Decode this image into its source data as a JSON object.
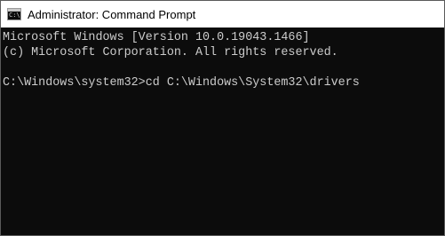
{
  "window": {
    "title": "Administrator: Command Prompt",
    "icon": "cmd-icon",
    "icon_glyph": "C:\\"
  },
  "console": {
    "lines": [
      "Microsoft Windows [Version 10.0.19043.1466]",
      "(c) Microsoft Corporation. All rights reserved.",
      "",
      "C:\\Windows\\system32>cd C:\\Windows\\System32\\drivers"
    ]
  },
  "colors": {
    "background": "#0c0c0c",
    "text": "#cccccc",
    "titlebar": "#ffffff"
  }
}
